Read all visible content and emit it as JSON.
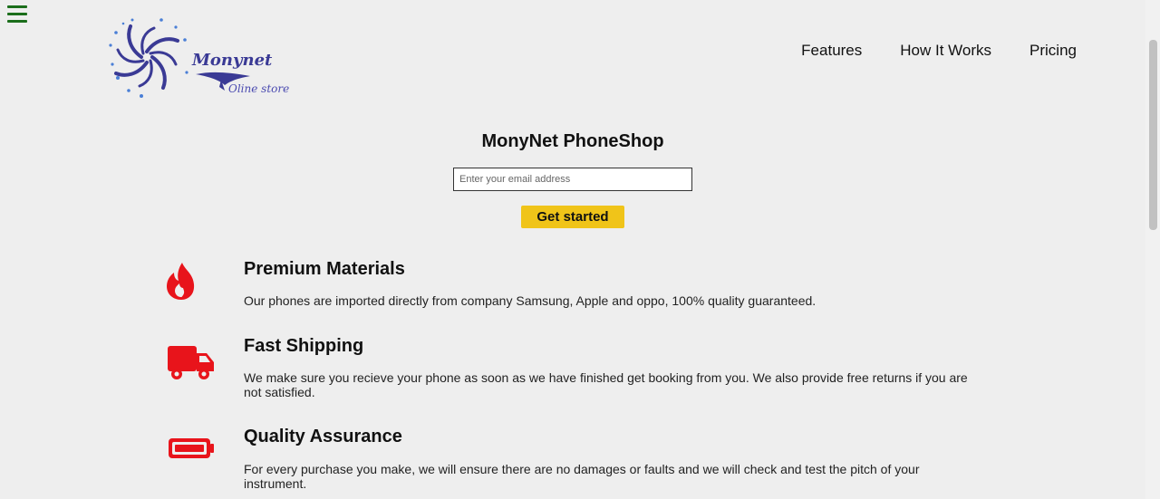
{
  "header": {
    "menu_icon": "hamburger-menu-icon",
    "logo": {
      "name": "Monynet",
      "tagline": "Oline store"
    },
    "nav": [
      {
        "label": "Features"
      },
      {
        "label": "How It Works"
      },
      {
        "label": "Pricing"
      }
    ]
  },
  "hero": {
    "title": "MonyNet PhoneShop",
    "email_placeholder": "Enter your email address",
    "cta_label": "Get started"
  },
  "features": [
    {
      "icon": "fire-icon",
      "title": "Premium Materials",
      "text": "Our phones are imported directly from company Samsung, Apple and oppo, 100% quality guaranteed."
    },
    {
      "icon": "truck-icon",
      "title": "Fast Shipping",
      "text": "We make sure you recieve your phone as soon as we have finished get booking from you. We also provide free returns if you are not satisfied."
    },
    {
      "icon": "battery-icon",
      "title": "Quality Assurance",
      "text": "For every purchase you make, we will ensure there are no damages or faults and we will check and test the pitch of your instrument."
    }
  ],
  "colors": {
    "background": "#eeeeee",
    "accent_button": "#f0c419",
    "icon_red": "#e8141b",
    "menu_green": "#1b6e1b",
    "logo_blue": "#3a3a95"
  }
}
